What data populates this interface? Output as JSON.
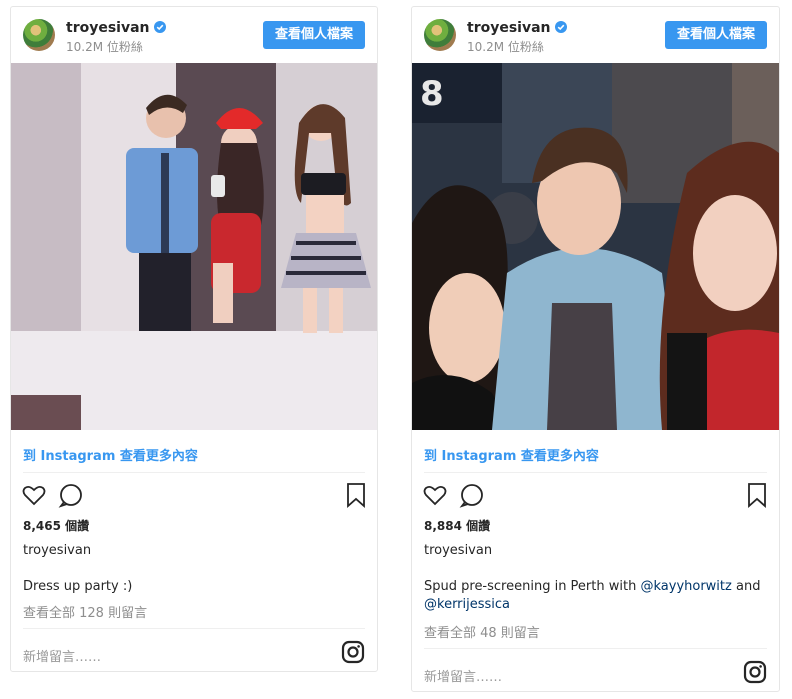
{
  "posts": [
    {
      "username": "troyesivan",
      "followers": "10.2M 位粉絲",
      "profile_button": "查看個人檔案",
      "more_link": "到 Instagram 查看更多內容",
      "likes": "8,465 個讚",
      "owner": "troyesivan",
      "caption_text": "Dress up party :)",
      "comments_link": "查看全部 128 則留言",
      "add_comment": "新增留言……"
    },
    {
      "username": "troyesivan",
      "followers": "10.2M 位粉絲",
      "profile_button": "查看個人檔案",
      "more_link": "到 Instagram 查看更多內容",
      "likes": "8,884 個讚",
      "owner": "troyesivan",
      "caption_text": "Spud pre-screening in Perth with",
      "mention_1": "@kayyhorwitz",
      "caption_and": "and",
      "mention_2": "@kerrijessica",
      "comments_link": "查看全部 48 則留言",
      "add_comment": "新增留言……"
    }
  ],
  "colors": {
    "accent": "#3897f0",
    "mention": "#003569",
    "muted": "#8e8e8e"
  },
  "icons": [
    "verified-badge-icon",
    "heart-icon",
    "comment-icon",
    "bookmark-icon",
    "instagram-logo-icon"
  ]
}
